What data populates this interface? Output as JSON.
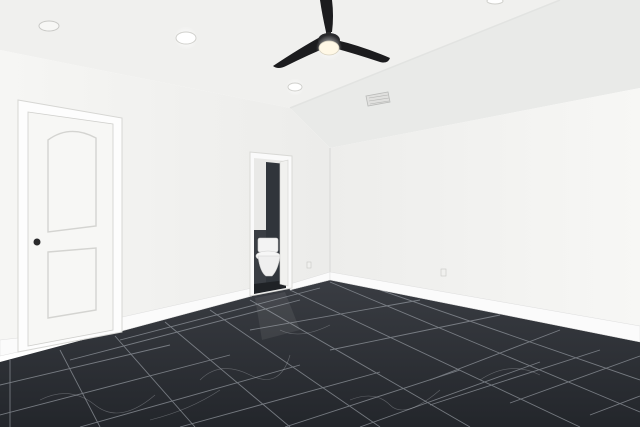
{
  "scene": {
    "colors": {
      "ceiling_left": "#f1f1ef",
      "ceiling_right": "#ecedeb",
      "wall_left": "#f3f3f1",
      "wall_back": "#eeeeec",
      "wall_right": "#f4f4f2",
      "baseboard": "#fbfbfb",
      "floor": "#2b2e33",
      "grout": "#9ea2a8",
      "door": "#f7f7f5",
      "door_panel_shadow": "#d9d9d6",
      "fan_blade": "#1c1c1e",
      "fan_light": "#fff8e6",
      "bathroom_dark": "#2f3338",
      "toilet": "#f2f2f2"
    }
  }
}
